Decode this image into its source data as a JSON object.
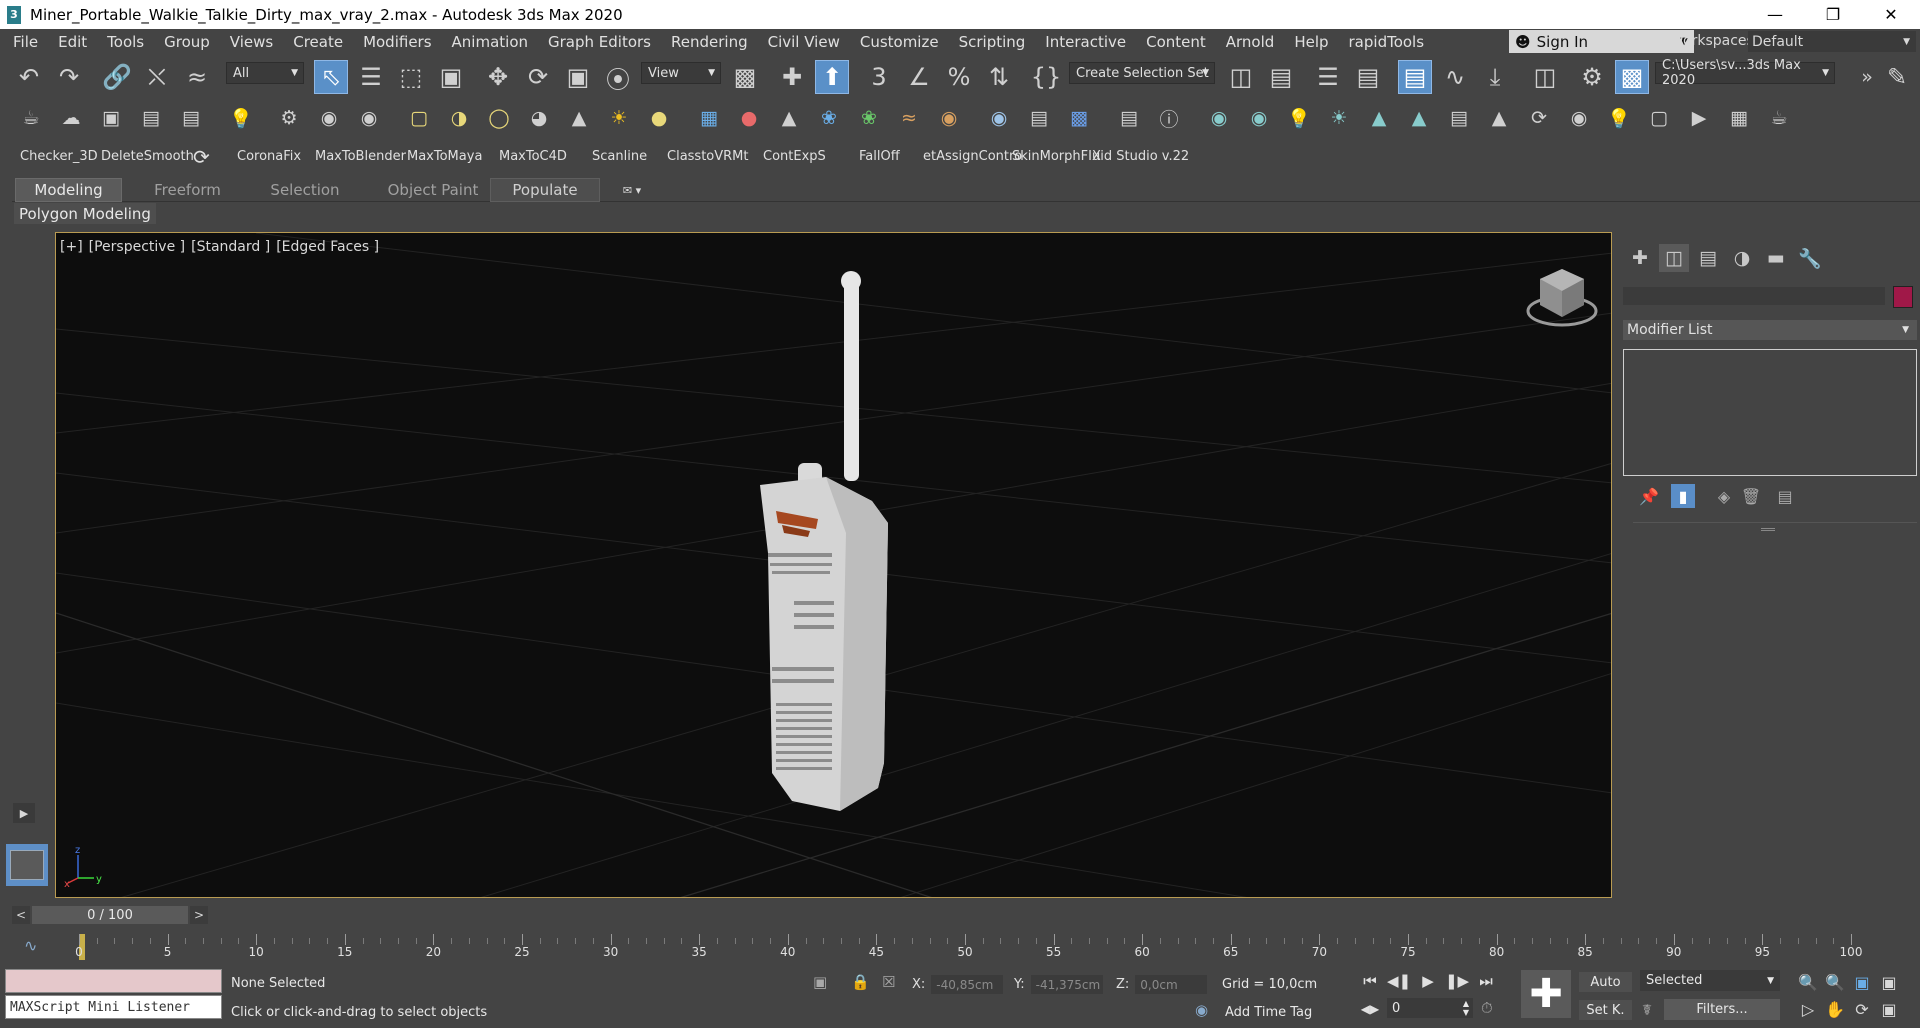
{
  "window": {
    "title": "Miner_Portable_Walkie_Talkie_Dirty_max_vray_2.max - Autodesk 3ds Max 2020",
    "app_icon": "3"
  },
  "menu": {
    "items": [
      "File",
      "Edit",
      "Tools",
      "Group",
      "Views",
      "Create",
      "Modifiers",
      "Animation",
      "Graph Editors",
      "Rendering",
      "Civil View",
      "Customize",
      "Scripting",
      "Interactive",
      "Content",
      "Arnold",
      "Help",
      "rapidTools"
    ],
    "sign_in": "Sign In",
    "workspaces_label": "Workspaces:",
    "workspace_value": "Default"
  },
  "toolbar": {
    "filter_value": "All",
    "ref_coord_value": "View",
    "selection_set_value": "Create Selection Set",
    "project_path": "C:\\Users\\sv...3ds Max 2020",
    "snap_3": "3"
  },
  "scripts_bar": {
    "items": [
      "Checker_3D",
      "DeleteSmooth",
      "CoronaFix",
      "MaxToBlender",
      "MaxToMaya",
      "MaxToC4D",
      "Scanline",
      "ClasstoVRMt",
      "ContExpS",
      "FallOff",
      "etAssignContro",
      "SkinMorphFIX",
      "uid Studio v.22"
    ]
  },
  "ribbon": {
    "tabs": [
      "Modeling",
      "Freeform",
      "Selection",
      "Object Paint",
      "Populate"
    ],
    "active_tab": "Modeling",
    "panel_label": "Polygon Modeling"
  },
  "viewport": {
    "labels": [
      "[+]",
      "[Perspective ]",
      "[Standard ]",
      "[Edged Faces ]"
    ],
    "axis_labels": {
      "x": "x",
      "y": "y",
      "z": "z"
    }
  },
  "command_panel": {
    "modifier_list_label": "Modifier List",
    "object_color": "#a01848"
  },
  "time": {
    "slider_label": "0 / 100",
    "prev": "<",
    "next": ">",
    "ticks": [
      "0",
      "5",
      "10",
      "15",
      "20",
      "25",
      "30",
      "35",
      "40",
      "45",
      "50",
      "55",
      "60",
      "65",
      "70",
      "75",
      "80",
      "85",
      "90",
      "95",
      "100"
    ]
  },
  "status": {
    "maxscript_label": "MAXScript Mini Listener",
    "selection_status": "None Selected",
    "prompt": "Click or click-and-drag to select objects",
    "x_label": "X:",
    "x_value": "-40,85cm",
    "y_label": "Y:",
    "y_value": "-41,375cm",
    "z_label": "Z:",
    "z_value": "0,0cm",
    "grid": "Grid = 10,0cm",
    "add_time_tag": "Add Time Tag",
    "auto_label": "Auto",
    "set_key_label": "Set K.",
    "selected_value": "Selected",
    "filters_label": "Filters...",
    "frame_value": "0"
  },
  "colors": {
    "accent_active": "#5a90c8",
    "viewport_border": "#b99b52",
    "viewport_bg": "#0d0d0d"
  }
}
